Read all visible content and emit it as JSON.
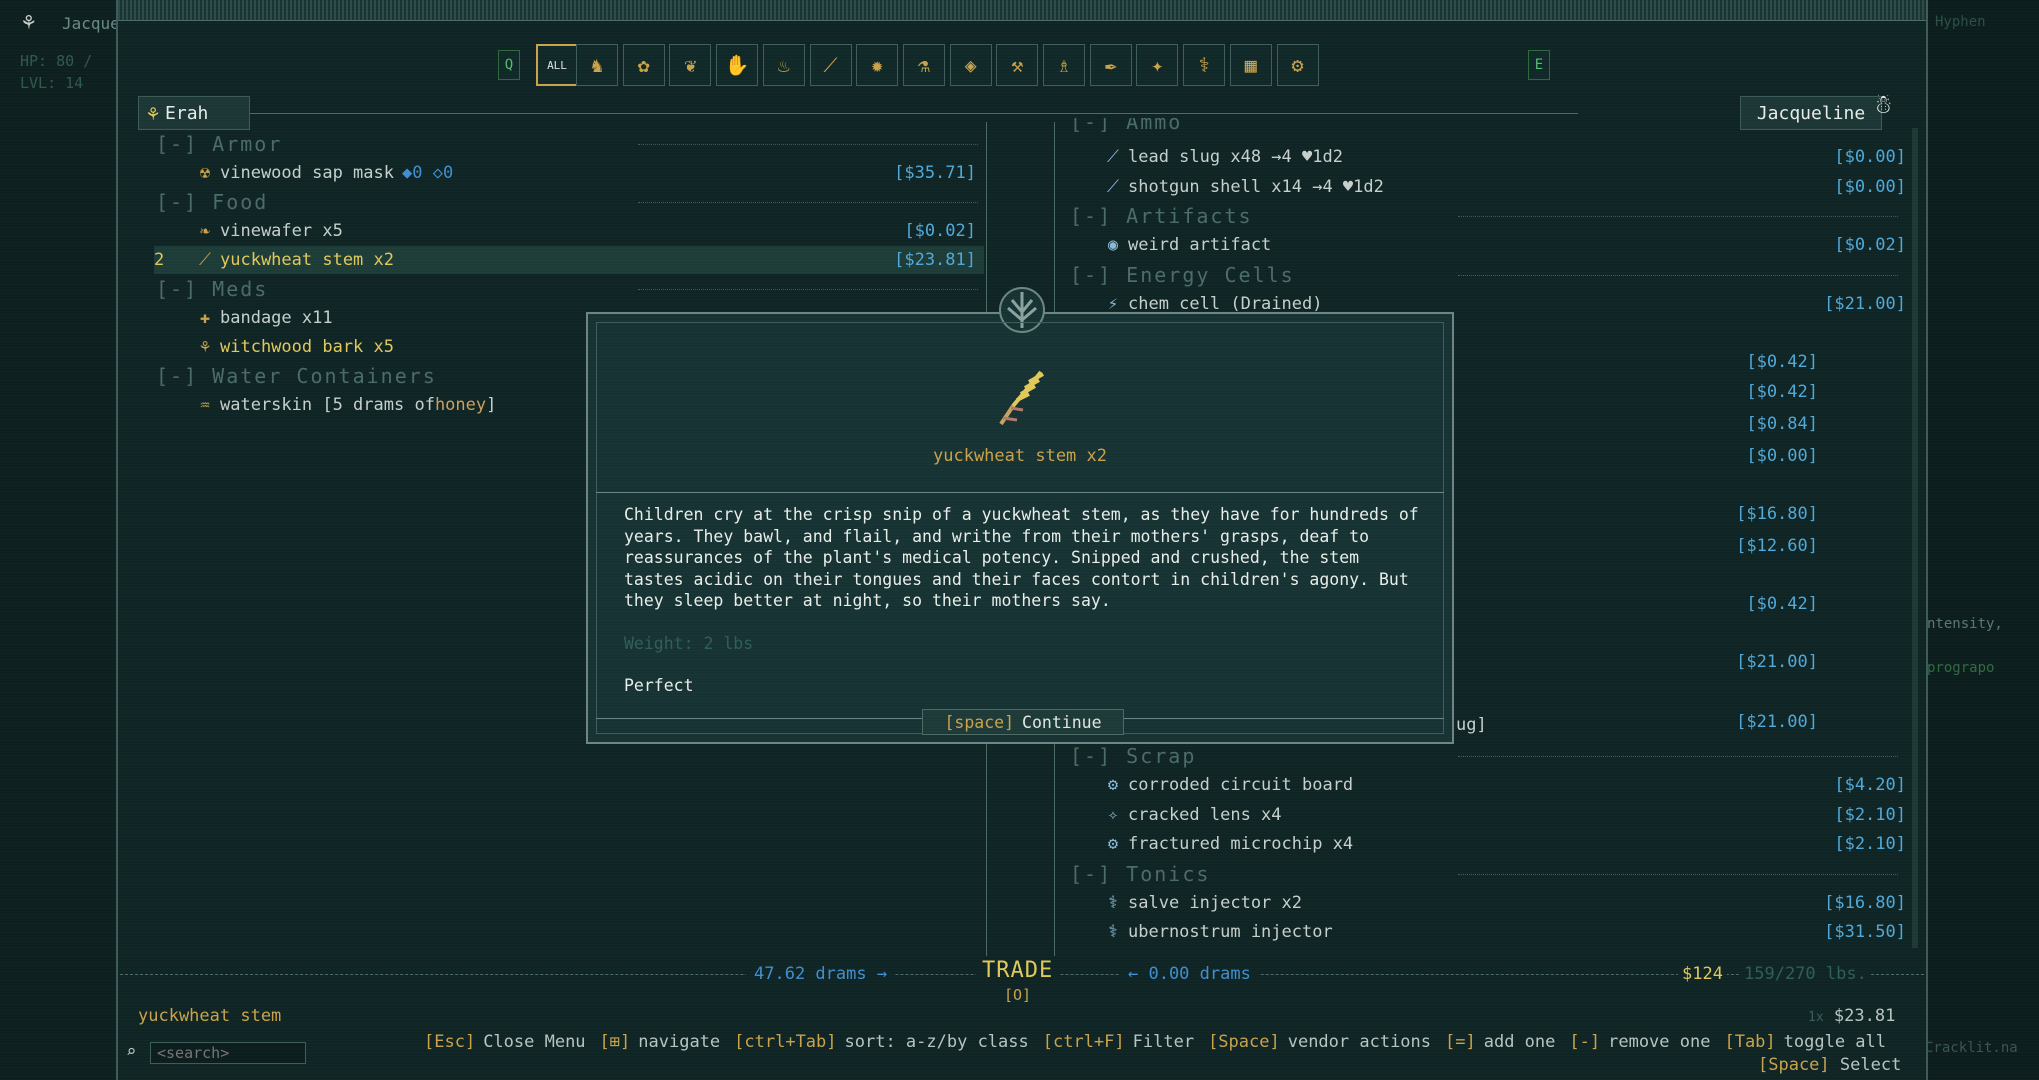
{
  "hud": {
    "player_short": "Jacque",
    "hp": "HP: 80 /",
    "lvl": "LVL: 14",
    "right_top": "Hyphen",
    "right_texts": [
      "ntensity,",
      "prograpo",
      "Cracklit.na"
    ]
  },
  "filters": {
    "left_key": "Q",
    "all_label": "ALL",
    "right_key": "E",
    "icons": [
      "armor-icon",
      "plant-icon",
      "fruit-icon",
      "gloves-icon",
      "meat-icon",
      "missile-icon",
      "grenade-icon",
      "tonic-icon",
      "cell-icon",
      "axe-icon",
      "trinket-icon",
      "feather-icon",
      "light-icon",
      "injector-icon",
      "chest-icon",
      "scrap-icon"
    ]
  },
  "left": {
    "name": "Erah",
    "categories": [
      {
        "label": "[-] Armor",
        "items": [
          {
            "name": "vinewood sap mask",
            "extra": "◆0 ◇0",
            "price": "[$35.71]",
            "color": "#c6cfcb"
          }
        ]
      },
      {
        "label": "[-] Food",
        "items": [
          {
            "name": "vinewafer x5",
            "price": "[$0.02]",
            "color": "#c6cfcb"
          },
          {
            "name": "yuckwheat stem x2",
            "price": "[$23.81]",
            "color": "#e0c85a",
            "selected": true,
            "count": "2"
          }
        ]
      },
      {
        "label": "[-] Meds",
        "items": [
          {
            "name": "bandage x11",
            "price": "",
            "color": "#c6cfcb"
          },
          {
            "name": "witchwood bark x5",
            "price": "",
            "color": "#e0c85a"
          }
        ]
      },
      {
        "label": "[-] Water Containers",
        "items": [
          {
            "name": "waterskin [5 drams of ",
            "honey": "honey",
            "tail": "]",
            "price": "",
            "color": "#c6cfcb"
          }
        ]
      }
    ]
  },
  "right": {
    "name": "Jacqueline",
    "top_cat": "[-] Ammo",
    "rows": [
      {
        "type": "item",
        "name": "lead slug x48 →4 ♥1d2",
        "price": "[$0.00]"
      },
      {
        "type": "item",
        "name": "shotgun shell x14 →4 ♥1d2",
        "price": "[$0.00]"
      },
      {
        "type": "cat",
        "name": "[-] Artifacts"
      },
      {
        "type": "item",
        "name": "weird artifact",
        "price": "[$0.02]"
      },
      {
        "type": "cat",
        "name": "[-] Energy Cells"
      },
      {
        "type": "item",
        "name": "chem cell (Drained)",
        "price": "[$21.00]"
      }
    ],
    "hidden_prices": [
      "[$0.42]",
      "[$0.42]",
      "[$0.84]",
      "[$0.00]",
      "[$16.80]",
      "[$12.60]",
      "[$0.42]",
      "[$21.00]",
      "[$21.00]"
    ],
    "partial_text": "ug]",
    "bottom_rows": [
      {
        "type": "cat",
        "name": "[-] Scrap"
      },
      {
        "type": "item",
        "name": "corroded circuit board",
        "price": "[$4.20]"
      },
      {
        "type": "item",
        "name": "cracked lens x4",
        "price": "[$2.10]"
      },
      {
        "type": "item",
        "name": "fractured microchip x4",
        "price": "[$2.10]"
      },
      {
        "type": "cat",
        "name": "[-] Tonics"
      },
      {
        "type": "item",
        "name": "salve injector x2",
        "price": "[$16.80]"
      },
      {
        "type": "item",
        "name": "ubernostrum injector",
        "price": "[$31.50]"
      }
    ]
  },
  "modal": {
    "title": "yuckwheat stem x2",
    "description": "Children cry at the crisp snip of a yuckwheat stem, as they have for hundreds of years. They bawl, and flail, and writhe from their mothers' grasps, deaf to reassurances of the plant's medical potency. Snipped and crushed, the stem tastes acidic on their tongues and their faces contort in children's agony. But they sleep better at night, so their mothers say.",
    "weight": "Weight: 2 lbs",
    "condition": "Perfect",
    "continue_key": "[space]",
    "continue_label": "Continue"
  },
  "trade": {
    "left_drams": "47.62 drams →",
    "label": "TRADE",
    "key": "[O]",
    "right_drams": "← 0.00 drams",
    "money": "$124",
    "weight": "159/270 lbs."
  },
  "footer": {
    "selected_item": "yuckwheat stem",
    "selected_price": "$23.81",
    "selected_count": "1x",
    "search_placeholder": "<search>",
    "hints": [
      {
        "key": "[Esc]",
        "label": "Close Menu"
      },
      {
        "key": "[⊞]",
        "label": "navigate"
      },
      {
        "key": "[ctrl+Tab]",
        "label": "sort: a-z/by class"
      },
      {
        "key": "[ctrl+F]",
        "label": "Filter"
      },
      {
        "key": "[Space]",
        "label": "vendor actions"
      },
      {
        "key": "[=]",
        "label": "add one"
      },
      {
        "key": "[-]",
        "label": "remove one"
      },
      {
        "key": "[Tab]",
        "label": "toggle all"
      }
    ],
    "select_key": "[Space]",
    "select_label": "Select"
  }
}
